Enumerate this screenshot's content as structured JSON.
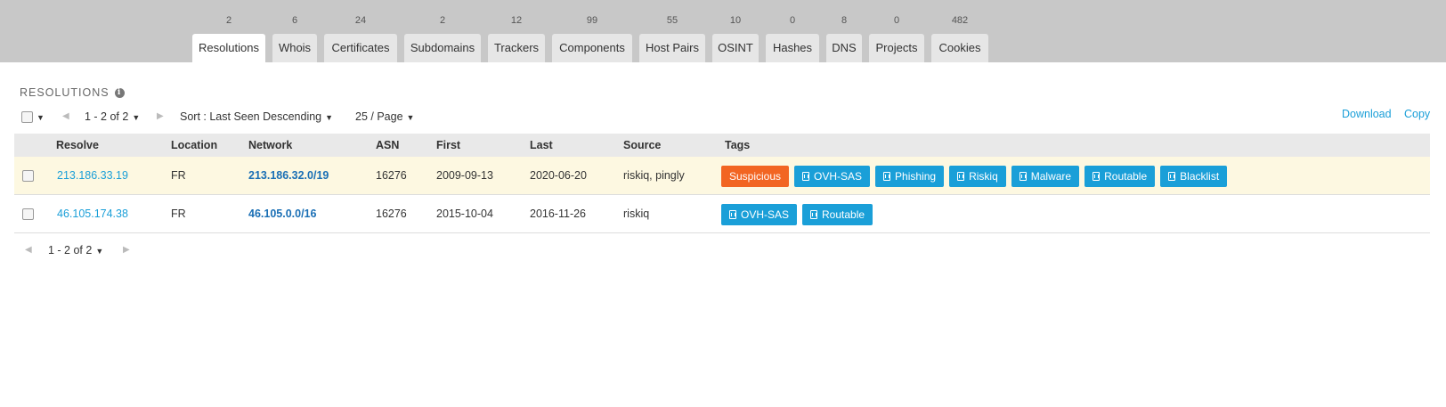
{
  "tabs": [
    {
      "label": "Resolutions",
      "count": "2",
      "active": true
    },
    {
      "label": "Whois",
      "count": "6"
    },
    {
      "label": "Certificates",
      "count": "24"
    },
    {
      "label": "Subdomains",
      "count": "2"
    },
    {
      "label": "Trackers",
      "count": "12"
    },
    {
      "label": "Components",
      "count": "99"
    },
    {
      "label": "Host Pairs",
      "count": "55"
    },
    {
      "label": "OSINT",
      "count": "10"
    },
    {
      "label": "Hashes",
      "count": "0"
    },
    {
      "label": "DNS",
      "count": "8"
    },
    {
      "label": "Projects",
      "count": "0"
    },
    {
      "label": "Cookies",
      "count": "482"
    }
  ],
  "section": {
    "title": "RESOLUTIONS",
    "info_icon": "info-icon"
  },
  "toolbar": {
    "pager_label": "1 - 2 of 2",
    "sort_label": "Sort : Last Seen Descending",
    "page_size_label": "25 / Page",
    "download_label": "Download",
    "copy_label": "Copy"
  },
  "table": {
    "columns": [
      "Resolve",
      "Location",
      "Network",
      "ASN",
      "First",
      "Last",
      "Source",
      "Tags"
    ],
    "rows": [
      {
        "resolve": "213.186.33.19",
        "location": "FR",
        "network": "213.186.32.0/19",
        "asn": "16276",
        "first": "2009-09-13",
        "last": "2020-06-20",
        "source": "riskiq, pingly",
        "tags": [
          "Suspicious",
          "OVH-SAS",
          "Phishing",
          "Riskiq",
          "Malware",
          "Routable",
          "Blacklist"
        ]
      },
      {
        "resolve": "46.105.174.38",
        "location": "FR",
        "network": "46.105.0.0/16",
        "asn": "16276",
        "first": "2015-10-04",
        "last": "2016-11-26",
        "source": "riskiq",
        "tags": [
          "OVH-SAS",
          "Routable"
        ]
      }
    ]
  },
  "footer": {
    "pager_label": "1 - 2 of 2"
  },
  "colors": {
    "accent": "#1a9fd8",
    "suspicious": "#f26522",
    "highlight_row": "#fdf8e1",
    "tabbar": "#c8c8c8"
  }
}
